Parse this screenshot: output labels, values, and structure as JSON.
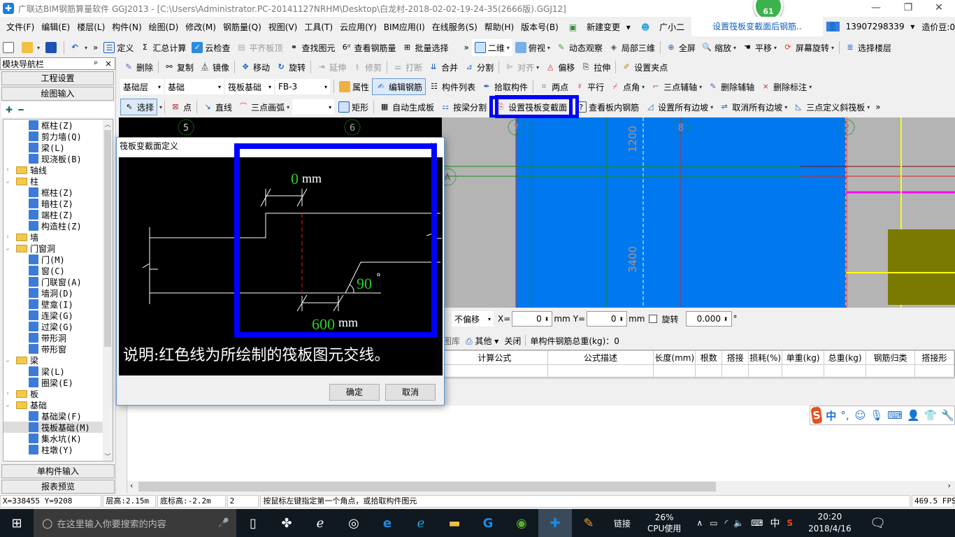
{
  "window": {
    "title": "广联达BIM钢筋算量软件 GGJ2013 - [C:\\Users\\Administrator.PC-20141127NRHM\\Desktop\\白龙村-2018-02-02-19-24-35(2666版).GGJ12]",
    "badge_count": "61",
    "minimize": "—",
    "restore": "❐",
    "close": "✕"
  },
  "menubar": {
    "items": [
      "文件(F)",
      "编辑(E)",
      "楼层(L)",
      "构件(N)",
      "绘图(D)",
      "修改(M)",
      "钢筋量(Q)",
      "视图(V)",
      "工具(T)",
      "云应用(Y)",
      "BIM应用(I)",
      "在线服务(S)",
      "帮助(H)",
      "版本号(B)"
    ],
    "new_change": "新建变更",
    "assistant": "广小二",
    "notice_link": "设置筏板变截面后钢筋..",
    "account": "13907298339",
    "coins": "造价豆:0",
    "overflow": "»"
  },
  "toolbar1": {
    "items": [
      "定义",
      "汇总计算",
      "云检查",
      "平齐板顶",
      "查找图元",
      "查看钢筋量",
      "批量选择"
    ],
    "view_items": [
      "二维",
      "俯视",
      "动态观察",
      "局部三维",
      "全屏",
      "缩放",
      "平移",
      "屏幕旋转",
      "选择楼层"
    ]
  },
  "toolbar2": {
    "items": [
      "删除",
      "复制",
      "镜像",
      "移动",
      "旋转",
      "延伸",
      "修剪",
      "打断",
      "合并",
      "分割",
      "对齐",
      "偏移",
      "拉伸",
      "设置夹点"
    ]
  },
  "toolbar3": {
    "floor": "基础层",
    "category": "基础",
    "type": "筏板基础",
    "component": "FB-3",
    "items": [
      "属性",
      "编辑钢筋",
      "构件列表",
      "拾取构件",
      "两点",
      "平行",
      "点角",
      "三点辅轴",
      "删除辅轴",
      "删除标注"
    ]
  },
  "toolbar4": {
    "items": [
      "选择",
      "点",
      "直线",
      "三点画弧",
      "矩形",
      "自动生成板",
      "按梁分割",
      "设置筏板变截面",
      "查看板内钢筋",
      "设置所有边坡",
      "取消所有边坡",
      "三点定义斜筏板"
    ],
    "highlighted": "设置筏板变截面"
  },
  "nav": {
    "title": "模块导航栏",
    "pin": "ᵖ",
    "close": "×",
    "btn_project": "工程设置",
    "btn_draw": "绘图输入",
    "btn_single": "单构件输入",
    "btn_report": "报表预览",
    "tree": [
      {
        "level": 1,
        "label": "框柱(Z)"
      },
      {
        "level": 1,
        "label": "剪力墙(Q)"
      },
      {
        "level": 1,
        "label": "梁(L)"
      },
      {
        "level": 1,
        "label": "现浇板(B)"
      },
      {
        "level": 0,
        "label": "轴线",
        "expanded": false
      },
      {
        "level": 0,
        "label": "柱",
        "expanded": true
      },
      {
        "level": 1,
        "label": "框柱(Z)"
      },
      {
        "level": 1,
        "label": "暗柱(Z)"
      },
      {
        "level": 1,
        "label": "端柱(Z)"
      },
      {
        "level": 1,
        "label": "构造柱(Z)"
      },
      {
        "level": 0,
        "label": "墙",
        "expanded": false
      },
      {
        "level": 0,
        "label": "门窗洞",
        "expanded": true
      },
      {
        "level": 1,
        "label": "门(M)"
      },
      {
        "level": 1,
        "label": "窗(C)"
      },
      {
        "level": 1,
        "label": "门联窗(A)"
      },
      {
        "level": 1,
        "label": "墙洞(D)"
      },
      {
        "level": 1,
        "label": "壁龛(I)"
      },
      {
        "level": 1,
        "label": "连梁(G)"
      },
      {
        "level": 1,
        "label": "过梁(G)"
      },
      {
        "level": 1,
        "label": "带形洞"
      },
      {
        "level": 1,
        "label": "带形窗"
      },
      {
        "level": 0,
        "label": "梁",
        "expanded": true
      },
      {
        "level": 1,
        "label": "梁(L)"
      },
      {
        "level": 1,
        "label": "圈梁(E)"
      },
      {
        "level": 0,
        "label": "板",
        "expanded": false
      },
      {
        "level": 0,
        "label": "基础",
        "expanded": true
      },
      {
        "level": 1,
        "label": "基础梁(F)"
      },
      {
        "level": 1,
        "label": "筏板基础(M)",
        "selected": true
      },
      {
        "level": 1,
        "label": "集水坑(K)"
      },
      {
        "level": 1,
        "label": "柱墩(Y)"
      }
    ]
  },
  "canvas": {
    "axis_labels": [
      "5",
      "6",
      "7",
      "8",
      "2",
      "A"
    ],
    "dims": [
      "1200",
      "3400"
    ]
  },
  "dialog": {
    "title": "筏板变截面定义",
    "top_value": "0",
    "top_unit": "mm",
    "angle_value": "90",
    "angle_unit": "°",
    "bottom_value": "600",
    "bottom_unit": "mm",
    "note": "说明:红色线为所绘制的筏板图元交线。",
    "ok": "确定",
    "cancel": "取消"
  },
  "options": {
    "offset_mode": "不偏移",
    "x_label": "X=",
    "x_value": "0",
    "y_label": "Y=",
    "y_value": "0",
    "unit": "mm",
    "rotate_label": "旋转",
    "rotate_value": "0.000",
    "deg": "°"
  },
  "rebar_toolbar": {
    "library": "图库",
    "other": "其他",
    "close": "关闭",
    "total": "单构件钢筋总重(kg)：0"
  },
  "rebar_table": {
    "columns": [
      "计算公式",
      "公式描述",
      "长度(mm)",
      "根数",
      "搭接",
      "损耗(%)",
      "单重(kg)",
      "总重(kg)",
      "钢筋归类",
      "搭接形"
    ]
  },
  "statusbar": {
    "coords": "X=338455 Y=9208",
    "floor_height": "层高:2.15m",
    "bottom_elev": "底标高:-2.2m",
    "count": "2",
    "hint": "按鼠标左键指定第一个角点，或拾取构件图元",
    "fps": "469.5 FPS"
  },
  "taskbar": {
    "search_placeholder": "在这里输入你要搜索的内容",
    "link": "链接",
    "cpu_pct": "26%",
    "cpu_label": "CPU使用",
    "ime": "中",
    "time": "20:20",
    "date": "2018/4/16"
  },
  "ime_bar": {
    "mode": "中",
    "punct": "°,"
  }
}
